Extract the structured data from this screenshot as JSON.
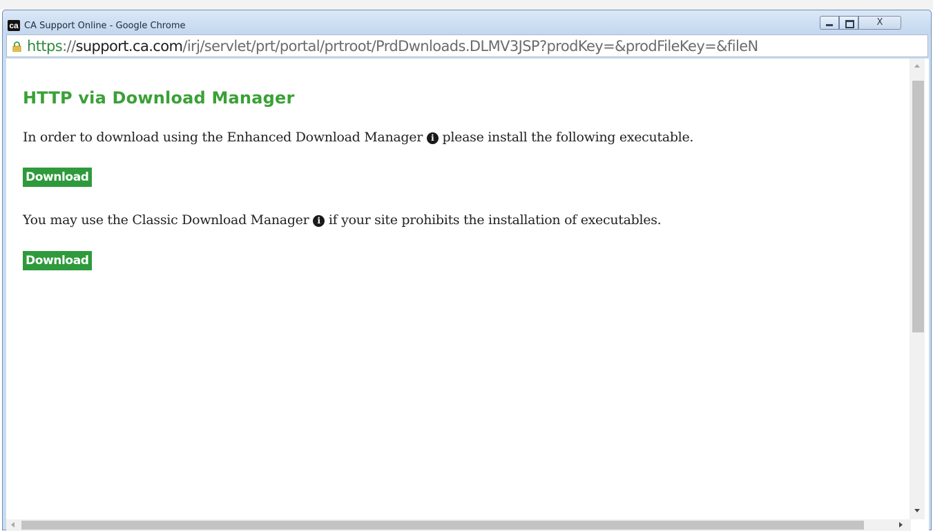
{
  "window": {
    "app_icon_text": "ca",
    "title": "CA Support Online - Google Chrome",
    "close_glyph": "X"
  },
  "addressbar": {
    "scheme": "https",
    "scheme_sep": "://",
    "host": "support.ca.com",
    "path": "/irj/servlet/prt/portal/prtroot/PrdDwnloads.DLMV3JSP?prodKey=&prodFileKey=&fileN"
  },
  "content": {
    "heading": "HTTP via Download Manager",
    "para1_before": "In order to download using the Enhanced Download Manager",
    "para1_after": "please install the following executable.",
    "info_glyph": "i",
    "button1_label": "Download",
    "para2_before": "You may use the Classic Download Manager",
    "para2_after": "if your site prohibits the installation of executables.",
    "button2_label": "Download"
  },
  "colors": {
    "heading": "#3aa136",
    "button_bg": "#2e9a3c",
    "secure_scheme": "#2f8a3c"
  },
  "icons": [
    "ca-app-icon",
    "minimize-icon",
    "maximize-icon",
    "close-icon",
    "lock-icon",
    "info-icon",
    "scroll-arrow-icon"
  ]
}
